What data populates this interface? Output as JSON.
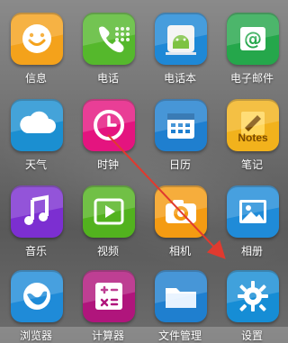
{
  "screen": {
    "apps": [
      {
        "id": "messages",
        "label": "信息",
        "icon": "smile-icon",
        "color": "#f4a21b"
      },
      {
        "id": "phone",
        "label": "电话",
        "icon": "phone-icon",
        "color": "#55b82c"
      },
      {
        "id": "contacts",
        "label": "电话本",
        "icon": "android-contacts-icon",
        "color": "#1e88d6"
      },
      {
        "id": "email",
        "label": "电子邮件",
        "icon": "at-mail-icon",
        "color": "#25a74b"
      },
      {
        "id": "weather",
        "label": "天气",
        "icon": "cloud-icon",
        "color": "#1b8fd1"
      },
      {
        "id": "clock",
        "label": "时钟",
        "icon": "clock-icon",
        "color": "#e4147f"
      },
      {
        "id": "calendar",
        "label": "日历",
        "icon": "calendar-icon",
        "color": "#1f7fcf"
      },
      {
        "id": "notes",
        "label": "笔记",
        "icon": "pencil-notes-icon",
        "color": "#f2b21c",
        "badge": "Notes"
      },
      {
        "id": "music",
        "label": "音乐",
        "icon": "music-note-icon",
        "color": "#7c2fd1"
      },
      {
        "id": "video",
        "label": "视频",
        "icon": "play-icon",
        "color": "#52b21e"
      },
      {
        "id": "camera",
        "label": "相机",
        "icon": "camera-icon",
        "color": "#f49b12"
      },
      {
        "id": "gallery",
        "label": "相册",
        "icon": "picture-icon",
        "color": "#1f8bd8"
      },
      {
        "id": "browser",
        "label": "浏览器",
        "icon": "globe-icon",
        "color": "#1f8bd8"
      },
      {
        "id": "calculator",
        "label": "计算器",
        "icon": "calculator-icon",
        "color": "#b0157c"
      },
      {
        "id": "files",
        "label": "文件管理",
        "icon": "folder-icon",
        "color": "#1f7fcf"
      },
      {
        "id": "settings",
        "label": "设置",
        "icon": "gear-icon",
        "color": "#168dd5"
      }
    ]
  },
  "annotation": {
    "arrow_color": "#e03a2f",
    "from": "clock",
    "to": "settings"
  }
}
